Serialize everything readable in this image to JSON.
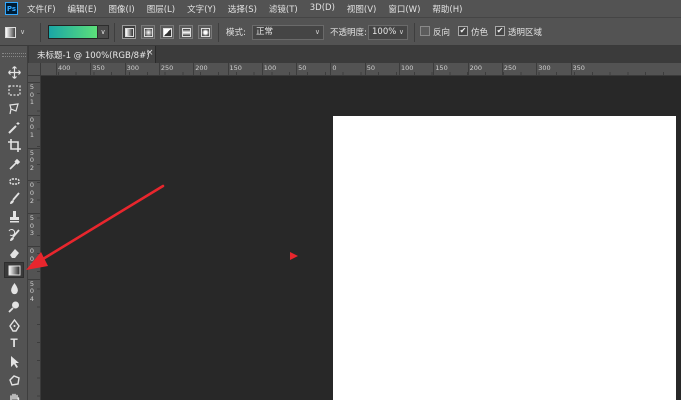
{
  "app": {
    "logo_text": "Ps"
  },
  "menu": [
    {
      "label": "文件(F)",
      "name": "menu-file"
    },
    {
      "label": "编辑(E)",
      "name": "menu-edit"
    },
    {
      "label": "图像(I)",
      "name": "menu-image"
    },
    {
      "label": "图层(L)",
      "name": "menu-layer"
    },
    {
      "label": "文字(Y)",
      "name": "menu-type"
    },
    {
      "label": "选择(S)",
      "name": "menu-select"
    },
    {
      "label": "滤镜(T)",
      "name": "menu-filter"
    },
    {
      "label": "3D(D)",
      "name": "menu-3d"
    },
    {
      "label": "视图(V)",
      "name": "menu-view"
    },
    {
      "label": "窗口(W)",
      "name": "menu-window"
    },
    {
      "label": "帮助(H)",
      "name": "menu-help"
    }
  ],
  "options": {
    "gradient": {
      "start_color": "#1aa6a6",
      "end_color": "#5ce07a"
    },
    "gradient_types": [
      "linear",
      "radial",
      "angle",
      "reflected",
      "diamond"
    ],
    "active_type": "linear",
    "mode_label": "模式:",
    "mode_value": "正常",
    "opacity_label": "不透明度:",
    "opacity_value": "100%",
    "reverse_label": "反向",
    "reverse_checked": false,
    "dither_label": "仿色",
    "dither_checked": true,
    "transparency_label": "透明区域",
    "transparency_checked": true,
    "check_mark": "✔"
  },
  "document": {
    "tab_title": "未标题-1 @ 100%(RGB/8#)",
    "close_glyph": "×",
    "canvas_color": "#ffffff",
    "pasteboard_color": "#282828"
  },
  "rulers": {
    "h_labels": [
      "400",
      "350",
      "300",
      "250",
      "200",
      "150",
      "100",
      "50",
      "0",
      "50",
      "100",
      "150",
      "200",
      "250",
      "300",
      "350"
    ],
    "v_labels": [
      "5",
      "0",
      "1",
      "0",
      "0",
      "1",
      "5",
      "0",
      "2",
      "0",
      "0",
      "2",
      "5",
      "0",
      "3",
      "0",
      "0",
      "3",
      "5",
      "0",
      "4"
    ]
  },
  "tools": [
    {
      "name": "move-tool-icon",
      "icon": "move"
    },
    {
      "name": "marquee-tool-icon",
      "icon": "marquee"
    },
    {
      "name": "lasso-tool-icon",
      "icon": "lasso"
    },
    {
      "name": "quick-select-tool-icon",
      "icon": "wand"
    },
    {
      "name": "crop-tool-icon",
      "icon": "crop"
    },
    {
      "name": "eyedropper-tool-icon",
      "icon": "eyedropper"
    },
    {
      "name": "healing-brush-tool-icon",
      "icon": "healing"
    },
    {
      "name": "brush-tool-icon",
      "icon": "brush"
    },
    {
      "name": "clone-stamp-tool-icon",
      "icon": "stamp"
    },
    {
      "name": "history-brush-tool-icon",
      "icon": "history"
    },
    {
      "name": "eraser-tool-icon",
      "icon": "eraser"
    },
    {
      "name": "gradient-tool-icon",
      "icon": "gradient",
      "selected": true
    },
    {
      "name": "blur-tool-icon",
      "icon": "blur"
    },
    {
      "name": "dodge-tool-icon",
      "icon": "dodge"
    },
    {
      "name": "pen-tool-icon",
      "icon": "pen"
    },
    {
      "name": "type-tool-icon",
      "icon": "type",
      "glyph": "T"
    },
    {
      "name": "path-select-tool-icon",
      "icon": "path-select"
    },
    {
      "name": "shape-tool-icon",
      "icon": "shape"
    },
    {
      "name": "hand-tool-icon",
      "icon": "hand"
    }
  ],
  "annotation": {
    "arrow_color": "#e8262d"
  }
}
